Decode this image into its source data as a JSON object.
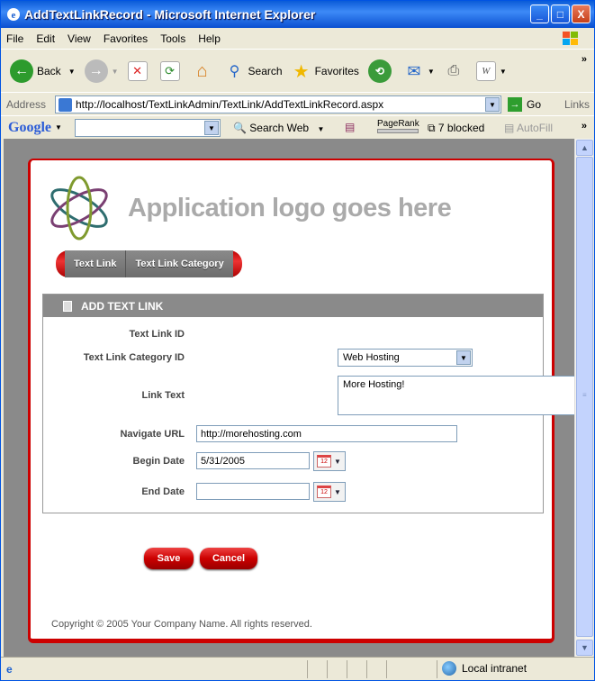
{
  "window": {
    "title": "AddTextLinkRecord - Microsoft Internet Explorer",
    "minimize": "_",
    "maximize": "□",
    "close": "X"
  },
  "menu": [
    "File",
    "Edit",
    "View",
    "Favorites",
    "Tools",
    "Help"
  ],
  "toolbar": {
    "back_label": "Back",
    "search_label": "Search",
    "favorites_label": "Favorites"
  },
  "address": {
    "label": "Address",
    "url": "http://localhost/TextLinkAdmin/TextLink/AddTextLinkRecord.aspx",
    "go_label": "Go",
    "links_label": "Links"
  },
  "google": {
    "logo": "Google",
    "search_web_label": "Search Web",
    "pagerank_label": "PageRank",
    "blocked_label": "7 blocked",
    "autofill_label": "AutoFill"
  },
  "page": {
    "logo_text": "Application logo goes here",
    "nav": [
      "Text Link",
      "Text Link Category"
    ],
    "panel_title": "ADD TEXT LINK",
    "fields": {
      "text_link_id_label": "Text Link ID",
      "category_label": "Text Link Category ID",
      "category_value": "Web Hosting",
      "link_text_label": "Link Text",
      "link_text_value": "More Hosting!",
      "navigate_url_label": "Navigate URL",
      "navigate_url_value": "http://morehosting.com",
      "begin_date_label": "Begin Date",
      "begin_date_value": "5/31/2005",
      "end_date_label": "End Date",
      "end_date_value": ""
    },
    "save_label": "Save",
    "cancel_label": "Cancel",
    "copyright": "Copyright © 2005 Your Company Name. All rights reserved."
  },
  "status": {
    "zone_label": "Local intranet"
  }
}
